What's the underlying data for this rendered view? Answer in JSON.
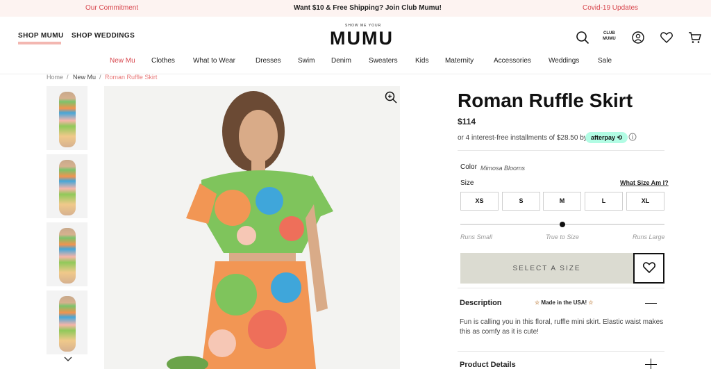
{
  "promo": {
    "left": "Our Commitment",
    "center": "Want $10 & Free Shipping? Join Club Mumu!",
    "right": "Covid-19 Updates"
  },
  "header": {
    "shop_mumu": "SHOP MUMU",
    "shop_weddings": "SHOP WEDDINGS",
    "logo_small": "SHOW ME YOUR",
    "logo": "MUMU",
    "club_top": "CLUB",
    "club_bottom": "MUMU",
    "icons": [
      "search-icon",
      "account-icon",
      "wishlist-icon",
      "cart-icon"
    ]
  },
  "nav": {
    "items": [
      "New Mu",
      "Clothes",
      "What to Wear",
      "Dresses",
      "Swim",
      "Denim",
      "Sweaters",
      "Kids",
      "Maternity",
      "Accessories",
      "Weddings",
      "Sale"
    ],
    "active_color": "#d8484f"
  },
  "breadcrumb": {
    "home": "Home",
    "sep": "/",
    "category": "New Mu",
    "current": "Roman Ruffle Skirt"
  },
  "product": {
    "title": "Roman Ruffle Skirt",
    "price": "$114",
    "installments": "or 4 interest-free installments of $28.50 by",
    "afterpay": "afterpay",
    "color_label": "Color",
    "color_value": "Mimosa Blooms",
    "size_label": "Size",
    "size_guide": "What Size Am I?",
    "sizes": [
      "XS",
      "S",
      "M",
      "L",
      "XL"
    ],
    "fit": {
      "small": "Runs Small",
      "true": "True to Size",
      "large": "Runs Large",
      "level": 0.5
    },
    "select_button": "SELECT A SIZE",
    "description_heading": "Description",
    "made_in": "Made in the USA!",
    "description": "Fun is calling you in this floral, ruffle mini skirt. Elastic waist makes this as comfy as it is cute!",
    "details_heading": "Product Details"
  },
  "colors": {
    "accent": "#d8484f",
    "promo_bg": "#fdf3f1",
    "afterpay_bg": "#b2fce4",
    "button_bg": "#dbdbd1"
  }
}
